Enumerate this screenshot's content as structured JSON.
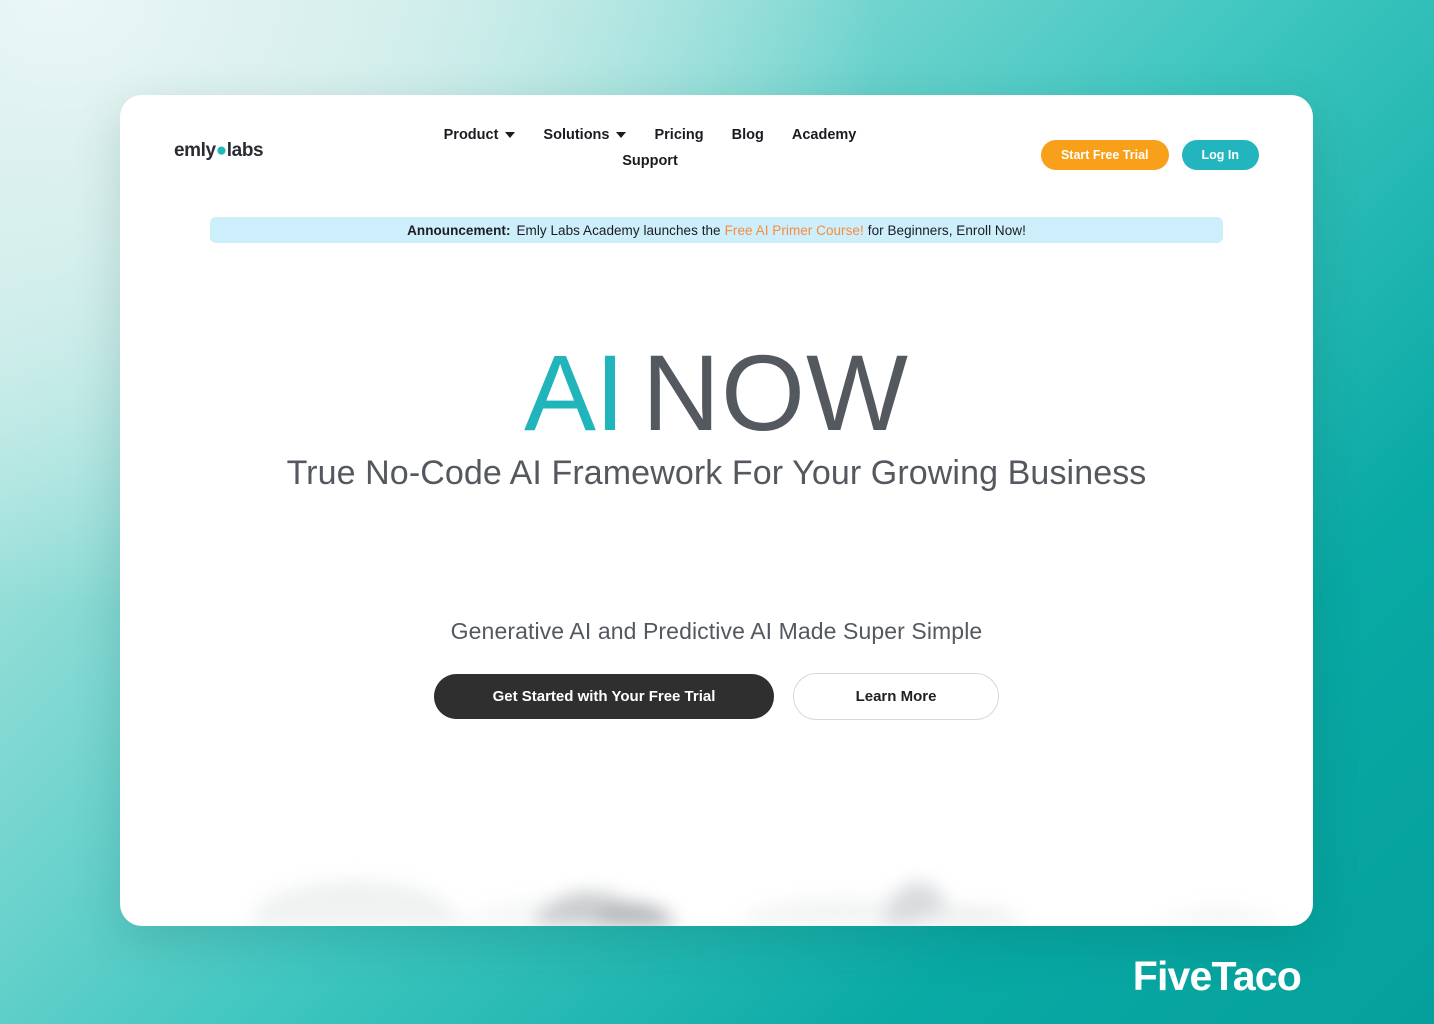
{
  "brand": {
    "logo_prefix": "emly",
    "logo_dot": "●",
    "logo_suffix": "labs"
  },
  "nav": {
    "items": [
      {
        "label": "Product",
        "has_caret": true
      },
      {
        "label": "Solutions",
        "has_caret": true
      },
      {
        "label": "Pricing",
        "has_caret": false
      },
      {
        "label": "Blog",
        "has_caret": false
      },
      {
        "label": "Academy",
        "has_caret": false
      },
      {
        "label": "Support",
        "has_caret": false
      }
    ]
  },
  "header_actions": {
    "trial_label": "Start Free Trial",
    "login_label": "Log In"
  },
  "announcement": {
    "prefix": "Announcement:",
    "text_before": "Emly Labs Academy launches the",
    "link": "Free AI Primer Course!",
    "text_after": "for Beginners, Enroll Now!"
  },
  "hero": {
    "title_accent": "AI",
    "title_rest": "NOW",
    "subtitle": "True No-Code AI Framework For Your Growing Business",
    "tagline": "Generative AI and Predictive AI Made Super Simple",
    "primary_cta": "Get Started with Your Free Trial",
    "secondary_cta": "Learn More"
  },
  "watermark": {
    "label": "FiveTaco"
  },
  "colors": {
    "teal_accent": "#21b5bb",
    "orange_button": "#f8a019",
    "login_teal": "#23b5bd",
    "announce_bg": "#cdeefb",
    "announce_link": "#f98b3c",
    "heading_gray": "#54585f",
    "primary_cta_bg": "#2f2f2f",
    "page_gradient_start": "#e6f5f3",
    "page_gradient_end": "#05a09c"
  }
}
